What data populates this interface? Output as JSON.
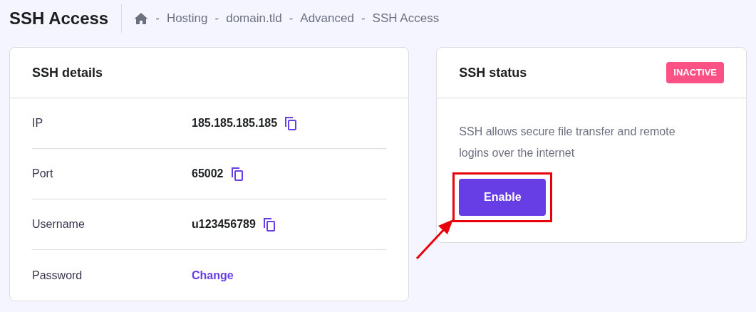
{
  "page": {
    "title": "SSH Access"
  },
  "breadcrumb": {
    "separator": "-",
    "items": [
      "Hosting",
      "domain.tld",
      "Advanced",
      "SSH Access"
    ]
  },
  "details": {
    "title": "SSH details",
    "rows": [
      {
        "kind": "copy",
        "label": "IP",
        "value": "185.185.185.185"
      },
      {
        "kind": "copy",
        "label": "Port",
        "value": "65002"
      },
      {
        "kind": "copy",
        "label": "Username",
        "value": "u123456789"
      },
      {
        "kind": "link",
        "label": "Password",
        "value": "Change"
      }
    ]
  },
  "status": {
    "title": "SSH status",
    "badge": "INACTIVE",
    "description": "SSH allows secure file transfer and remote logins over the internet",
    "button": "Enable",
    "highlighted": true
  }
}
